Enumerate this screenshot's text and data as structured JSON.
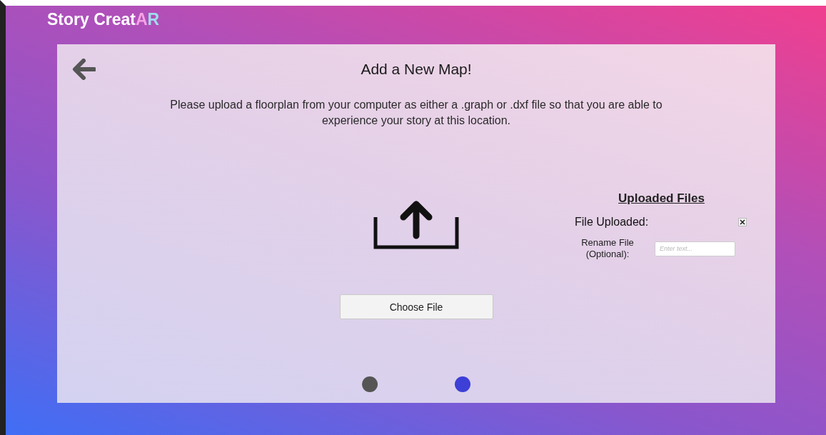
{
  "app_title": {
    "parts": [
      {
        "text": "Story Creat",
        "color": "#ffffff"
      },
      {
        "text": "A",
        "color": "#f5a3e6"
      },
      {
        "text": "R",
        "color": "#9fdcec"
      }
    ]
  },
  "page": {
    "title": "Add a New Map!",
    "description": "Please upload a floorplan from your computer as either a .graph or .dxf file so that you are able to experience your story at this location."
  },
  "upload": {
    "button": "Choose File"
  },
  "uploaded_files": {
    "heading": "Uploaded Files",
    "file_label": "File Uploaded:",
    "file_checked": true,
    "rename_label": "Rename File (Optional):",
    "rename_placeholder": "Enter text..."
  },
  "pager": [
    {
      "selected": false
    },
    {
      "selected": true
    }
  ]
}
